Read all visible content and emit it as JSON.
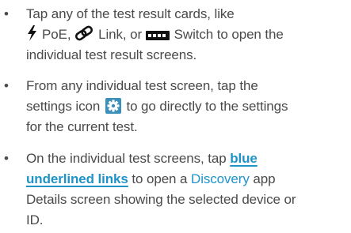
{
  "items": [
    {
      "line1": "Tap any of the test result cards, like",
      "poe_label": "PoE,",
      "link_label": "Link, or",
      "switch_label": "Switch to open the",
      "line3": "individual test result screens."
    },
    {
      "line1": "From any individual test screen, tap the",
      "line2_before": "settings icon",
      "line2_after": "to go directly to the settings",
      "line3": "for the current test."
    },
    {
      "line1_before": "On the individual test screens, tap",
      "link_word1": "blue",
      "link_word2": "underlined links",
      "line2_mid": "to open a",
      "app_name": "Discovery",
      "line2_end": "app",
      "line3": "Details screen showing the selected device or",
      "line4": "ID."
    }
  ],
  "bullet_glyph": "•",
  "icons": {
    "poe": "lightning-bolt-icon",
    "link": "chain-link-icon",
    "switch": "switch-icon",
    "settings": "gear-icon"
  },
  "colors": {
    "text": "#4a4a4a",
    "link_blue": "#1f93c8",
    "icon_dark": "#111111",
    "settings_bg": "#3b8fb8"
  }
}
